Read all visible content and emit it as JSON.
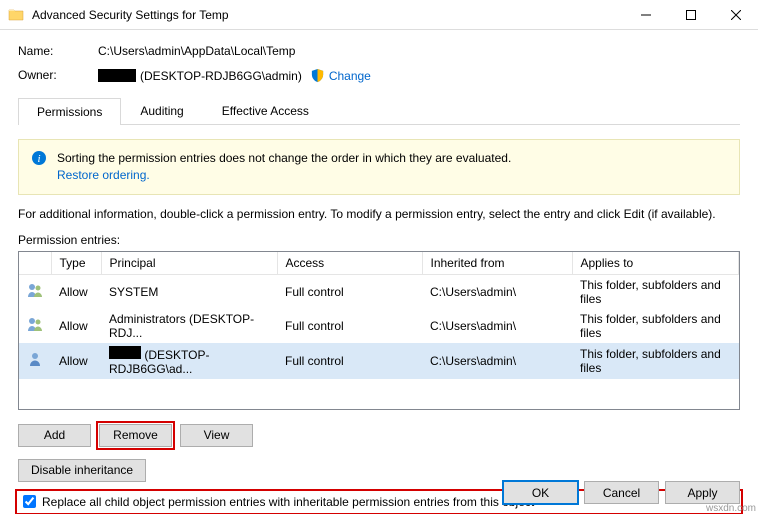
{
  "window": {
    "title": "Advanced Security Settings for Temp"
  },
  "header": {
    "name_label": "Name:",
    "name_value": "C:\\Users\\admin\\AppData\\Local\\Temp",
    "owner_label": "Owner:",
    "owner_value": "(DESKTOP-RDJB6GG\\admin)",
    "change_link": "Change"
  },
  "tabs": {
    "permissions": "Permissions",
    "auditing": "Auditing",
    "effective": "Effective Access"
  },
  "banner": {
    "text": "Sorting the permission entries does not change the order in which they are evaluated.",
    "restore_link": "Restore ordering."
  },
  "instruction": "For additional information, double-click a permission entry. To modify a permission entry, select the entry and click Edit (if available).",
  "entries_label": "Permission entries:",
  "columns": {
    "type": "Type",
    "principal": "Principal",
    "access": "Access",
    "inherited": "Inherited from",
    "applies": "Applies to"
  },
  "rows": [
    {
      "type": "Allow",
      "principal": "SYSTEM",
      "redacted": false,
      "access": "Full control",
      "inherited": "C:\\Users\\admin\\",
      "applies": "This folder, subfolders and files"
    },
    {
      "type": "Allow",
      "principal": "Administrators (DESKTOP-RDJ...",
      "redacted": false,
      "access": "Full control",
      "inherited": "C:\\Users\\admin\\",
      "applies": "This folder, subfolders and files"
    },
    {
      "type": "Allow",
      "principal": " (DESKTOP-RDJB6GG\\ad...",
      "redacted": true,
      "access": "Full control",
      "inherited": "C:\\Users\\admin\\",
      "applies": "This folder, subfolders and files"
    }
  ],
  "buttons": {
    "add": "Add",
    "remove": "Remove",
    "view": "View",
    "disable_inherit": "Disable inheritance",
    "ok": "OK",
    "cancel": "Cancel",
    "apply": "Apply"
  },
  "replace_checkbox": "Replace all child object permission entries with inheritable permission entries from this object",
  "watermark": "wsxdn.com"
}
